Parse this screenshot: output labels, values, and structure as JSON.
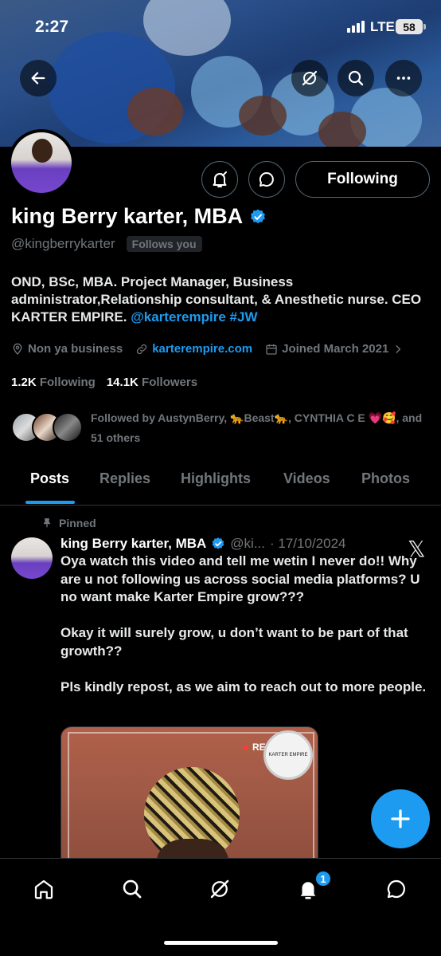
{
  "status_bar": {
    "time": "2:27",
    "network": "LTE",
    "battery": "58"
  },
  "profile": {
    "name": "king Berry karter, MBA",
    "handle": "@kingberrykarter",
    "follows_you": "Follows you",
    "bio_plain": "OND, BSc, MBA. Project Manager, Business administrator,Relationship consultant, & Anesthetic nurse. CEO KARTER EMPIRE.",
    "bio_mention": "@karterempire",
    "bio_hashtag": "#JW",
    "location": "Non ya business",
    "website": "karterempire.com",
    "joined": "Joined March 2021",
    "following_count": "1.2K",
    "following_label": "Following",
    "followers_count": "14.1K",
    "followers_label": "Followers",
    "followed_by": "Followed by AustynBerry, 🐆Beast🐆, CYNTHIA C E 💗🥰, and 51 others",
    "following_button": "Following"
  },
  "tabs": [
    "Posts",
    "Replies",
    "Highlights",
    "Videos",
    "Photos"
  ],
  "active_tab": "Posts",
  "post": {
    "pinned_label": "Pinned",
    "author": "king Berry karter, MBA",
    "handle": "@ki...",
    "date": "· 17/10/2024",
    "text": "Oya watch this video and tell me wetin I never do!! Why are u not following us across social media platforms? U no want make Karter Empire grow???\n\nOkay it will surely grow, u don’t want to be part of that growth??\n\nPls kindly repost, as we aim to reach out to more people.",
    "media_rec": "RE",
    "media_stamp": "KARTER EMPIRE"
  },
  "nav": {
    "notification_badge": "1"
  },
  "colors": {
    "accent": "#1d9bf0",
    "background": "#000000",
    "muted": "#71767b"
  }
}
